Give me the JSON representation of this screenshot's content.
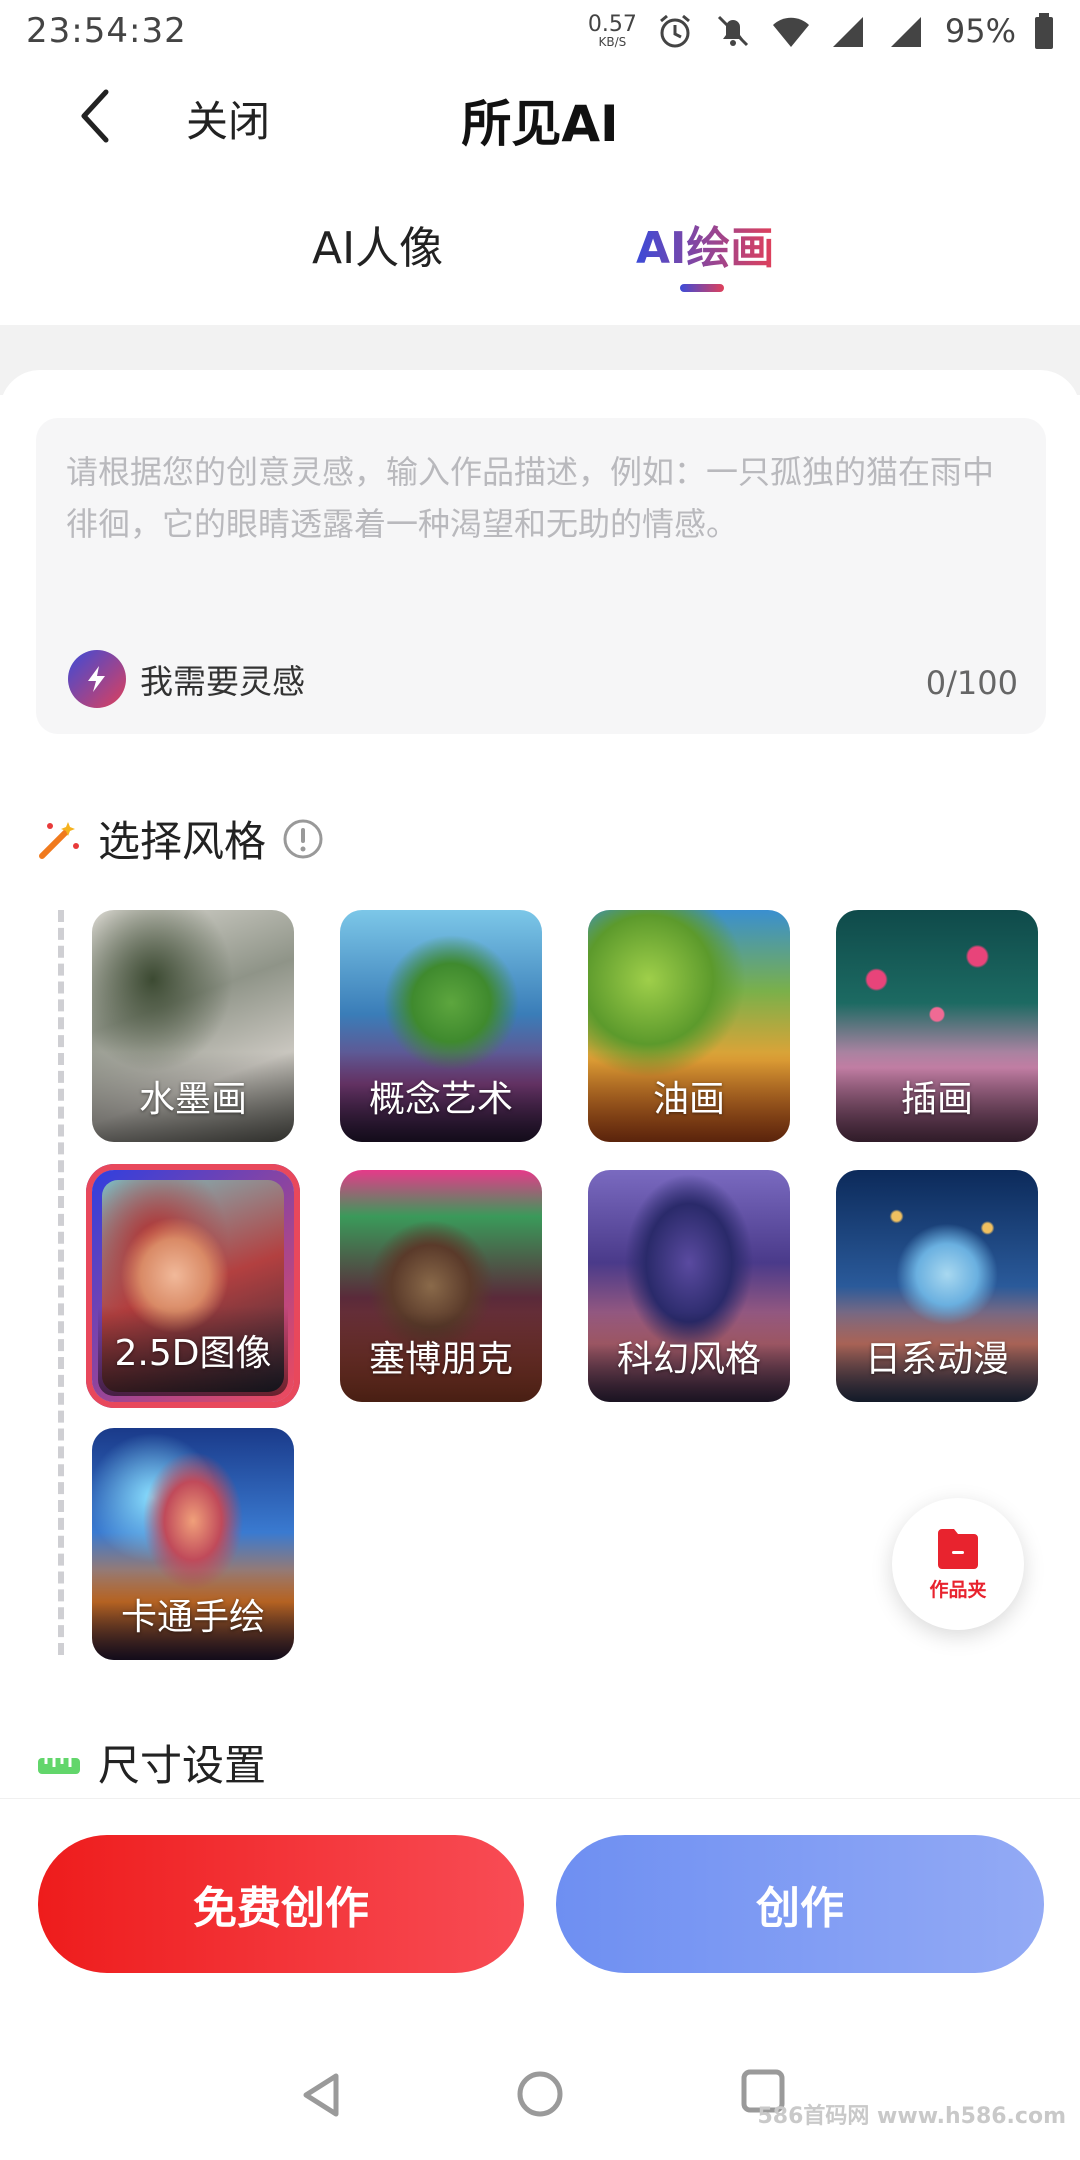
{
  "status_bar": {
    "time": "23:54:32",
    "net_speed": "0.57",
    "net_unit": "KB/S",
    "battery": "95%",
    "icons": [
      "alarm-icon",
      "bell-off-icon",
      "wifi-icon",
      "signal-icon",
      "signal-icon",
      "battery-icon"
    ]
  },
  "title_bar": {
    "close_label": "关闭",
    "title": "所见AI"
  },
  "tabs": [
    {
      "label": "AI人像",
      "active": false
    },
    {
      "label": "AI绘画",
      "active": true
    }
  ],
  "prompt": {
    "placeholder": "请根据您的创意灵感，输入作品描述，例如：一只孤独的猫在雨中徘徊，它的眼睛透露着一种渴望和无助的情感。",
    "inspiration_label": "我需要灵感",
    "counter": "0/100"
  },
  "style_section": {
    "title": "选择风格",
    "styles": [
      {
        "label": "水墨画",
        "selected": false
      },
      {
        "label": "概念艺术",
        "selected": false
      },
      {
        "label": "油画",
        "selected": false
      },
      {
        "label": "插画",
        "selected": false
      },
      {
        "label": "2.5D图像",
        "selected": true
      },
      {
        "label": "塞博朋克",
        "selected": false
      },
      {
        "label": "科幻风格",
        "selected": false
      },
      {
        "label": "日系动漫",
        "selected": false
      },
      {
        "label": "卡通手绘",
        "selected": false
      }
    ]
  },
  "folder_button": {
    "label": "作品夹"
  },
  "size_section": {
    "title": "尺寸设置"
  },
  "actions": {
    "free_create": "免费创作",
    "create": "创作"
  },
  "watermark": "586首码网 www.h586.com",
  "colors": {
    "accent_blue": "#3c4bd8",
    "accent_red": "#e0405a",
    "free_button": "#ee1c1c",
    "create_button": "#7d99f3"
  }
}
